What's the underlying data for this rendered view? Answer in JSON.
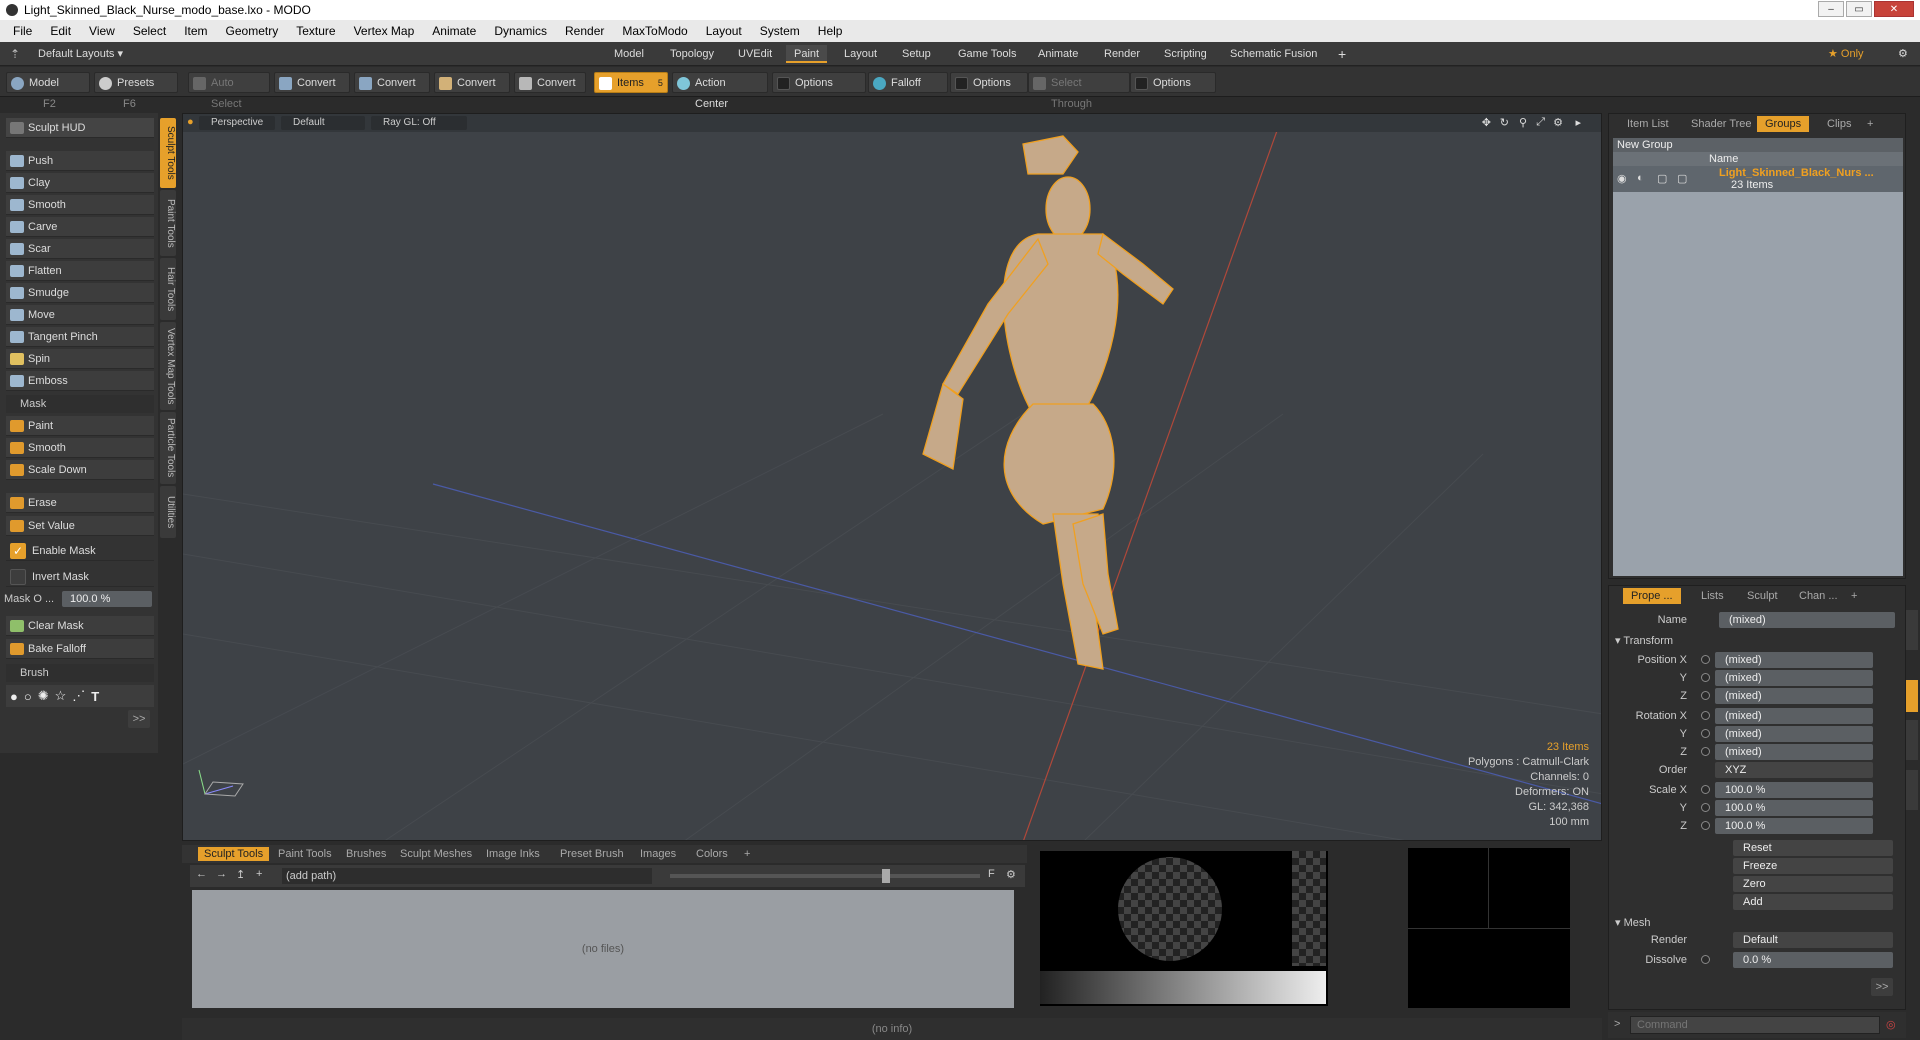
{
  "window": {
    "title": "Light_Skinned_Black_Nurse_modo_base.lxo - MODO",
    "controls": [
      "–",
      "▭",
      "✕"
    ]
  },
  "menu": [
    "File",
    "Edit",
    "View",
    "Select",
    "Item",
    "Geometry",
    "Texture",
    "Vertex Map",
    "Animate",
    "Dynamics",
    "Render",
    "MaxToModo",
    "Layout",
    "System",
    "Help"
  ],
  "layoutbar": {
    "layouts_label": "Default Layouts ▾",
    "tabs": [
      "Model",
      "Topology",
      "UVEdit",
      "Paint",
      "Layout",
      "Setup",
      "Game Tools",
      "Animate",
      "Render",
      "Scripting",
      "Schematic Fusion"
    ],
    "active_tab": "Paint",
    "add": "+",
    "only": "★ Only",
    "gear": "⚙"
  },
  "toolbar": {
    "model": "Model",
    "model_key": "F2",
    "presets": "Presets",
    "presets_key": "F6",
    "auto_select": "Auto Select",
    "convert1": "Convert",
    "convert2": "Convert",
    "convert3": "Convert",
    "convert4": "Convert",
    "items": "Items",
    "items_key": "5",
    "action_center": "Action Center",
    "options1": "Options",
    "falloff": "Falloff",
    "options2": "Options",
    "select_through": "Select Through",
    "options3": "Options"
  },
  "leftpanel": {
    "hud": "Sculpt HUD",
    "tools": [
      "Push",
      "Clay",
      "Smooth",
      "Carve",
      "Scar",
      "Flatten",
      "Smudge",
      "Move",
      "Tangent Pinch",
      "Spin",
      "Emboss"
    ],
    "mask_header": "Mask",
    "mask_tools": [
      "Paint",
      "Smooth",
      "Scale Down"
    ],
    "erase": "Erase",
    "set_value": "Set Value",
    "enable_mask": "Enable Mask",
    "invert_mask": "Invert Mask",
    "mask_opacity_label": "Mask O ...",
    "mask_opacity_value": "100.0 %",
    "clear_mask": "Clear Mask",
    "bake_falloff": "Bake Falloff",
    "brush_header": "Brush",
    "more": ">>"
  },
  "vtabs": [
    "Sculpt Tools",
    "Paint Tools",
    "Hair Tools",
    "Vertex Map Tools",
    "Particle Tools",
    "Utilities"
  ],
  "viewport": {
    "view": "Perspective",
    "shading": "Default",
    "raygl": "Ray GL: Off",
    "info": {
      "items": "23 Items",
      "polygons": "Polygons : Catmull-Clark",
      "channels": "Channels: 0",
      "deformers": "Deformers: ON",
      "gl": "GL: 342,368",
      "scale": "100 mm"
    }
  },
  "bottom": {
    "tabs": [
      "Sculpt Tools",
      "Paint Tools",
      "Brushes",
      "Sculpt Meshes",
      "Image Inks",
      "Preset Brush",
      "Images",
      "Colors",
      "+"
    ],
    "active_tab": "Sculpt Tools",
    "path": "(add path)",
    "no_files": "(no files)",
    "status": "(no info)"
  },
  "righttop": {
    "tabs": [
      "Item List",
      "Shader Tree",
      "Groups",
      "Clips",
      "+"
    ],
    "active_tab": "Groups",
    "new_group": "New Group",
    "name_header": "Name",
    "group_name": "Light_Skinned_Black_Nurs ...",
    "group_count": "23 Items"
  },
  "properties": {
    "tabs": [
      "Prope ...",
      "Lists",
      "Sculpt",
      "Chan ...",
      "+"
    ],
    "active_tab": "Prope ...",
    "name_label": "Name",
    "name_value": "(mixed)",
    "transform": "Transform",
    "position_x": "Position X",
    "y": "Y",
    "z": "Z",
    "rotation_x": "Rotation X",
    "mixed": "(mixed)",
    "order_label": "Order",
    "order_value": "XYZ",
    "scale_x": "Scale X",
    "scale_value": "100.0 %",
    "reset": "Reset",
    "freeze": "Freeze",
    "zero": "Zero",
    "add": "Add",
    "mesh": "Mesh",
    "render_label": "Render",
    "render_value": "Default",
    "dissolve_label": "Dissolve",
    "dissolve_value": "0.0 %",
    "more": ">>"
  },
  "command": {
    "placeholder": "Command"
  },
  "colors": {
    "accent": "#e6a02b",
    "viewport_bg": "#3e4247",
    "wire": "#f0a020"
  }
}
